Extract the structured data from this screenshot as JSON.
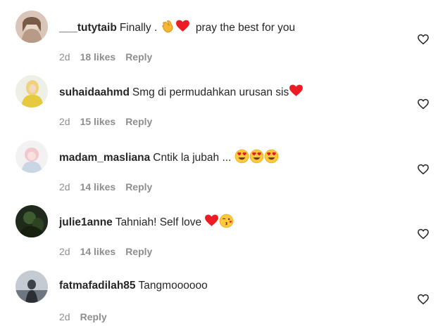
{
  "comments": [
    {
      "username": "___tutytaib",
      "text": "Finally .",
      "text_after": "pray the best for you",
      "emojis": [
        "clapping-hands-emoji",
        "red-heart-emoji"
      ],
      "age": "2d",
      "likes": "18 likes",
      "reply": "Reply"
    },
    {
      "username": "suhaidaahmd",
      "text": "Smg di permudahkan urusan sis",
      "emojis": [
        "red-heart-emoji"
      ],
      "age": "2d",
      "likes": "15 likes",
      "reply": "Reply"
    },
    {
      "username": "madam_masliana",
      "text": "Cntik la jubah ...",
      "emojis": [
        "heart-eyes-emoji",
        "heart-eyes-emoji",
        "heart-eyes-emoji"
      ],
      "age": "2d",
      "likes": "14 likes",
      "reply": "Reply"
    },
    {
      "username": "julie1anne",
      "text": "Tahniah! Self love",
      "emojis": [
        "red-heart-emoji",
        "kissing-face-emoji"
      ],
      "age": "2d",
      "likes": "14 likes",
      "reply": "Reply"
    },
    {
      "username": "fatmafadilah85",
      "text": "Tangmoooooo",
      "emojis": [],
      "age": "2d",
      "likes": "",
      "reply": "Reply"
    }
  ],
  "colors": {
    "text": "#262626",
    "muted": "#8e8e8e",
    "heart_red": "#ed1c24",
    "emoji_yellow": "#ffc83d"
  }
}
